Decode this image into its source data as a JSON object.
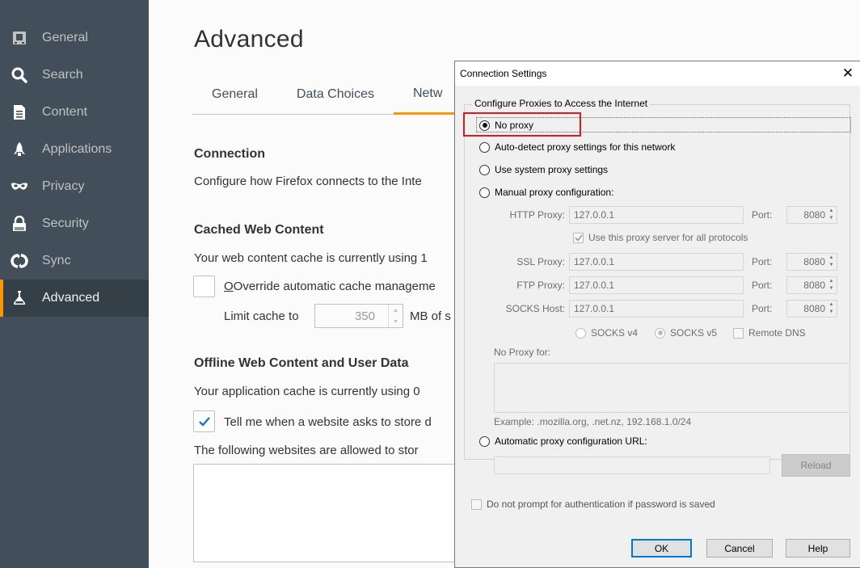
{
  "sidebar": {
    "items": [
      {
        "label": "General",
        "icon": "general-icon"
      },
      {
        "label": "Search",
        "icon": "search-icon"
      },
      {
        "label": "Content",
        "icon": "content-icon"
      },
      {
        "label": "Applications",
        "icon": "applications-icon"
      },
      {
        "label": "Privacy",
        "icon": "privacy-mask-icon"
      },
      {
        "label": "Security",
        "icon": "security-lock-icon"
      },
      {
        "label": "Sync",
        "icon": "sync-icon"
      },
      {
        "label": "Advanced",
        "icon": "advanced-icon"
      }
    ],
    "active": "Advanced"
  },
  "main": {
    "title": "Advanced",
    "tabs": [
      {
        "label": "General"
      },
      {
        "label": "Data Choices"
      },
      {
        "label": "Netw"
      }
    ],
    "connection": {
      "title": "Connection",
      "text": "Configure how Firefox connects to the Inte"
    },
    "cache": {
      "title": "Cached Web Content",
      "text": "Your web content cache is currently using 1",
      "override_label": "Override automatic cache manageme",
      "limit_label": "Limit cache to",
      "limit_value": "350",
      "unit_label": "MB of s"
    },
    "offline": {
      "title": "Offline Web Content and User Data",
      "text": "Your application cache is currently using 0",
      "tell_me_label": "Tell me when a website asks to store d",
      "allowed_text": "The following websites are allowed to stor"
    }
  },
  "dialog": {
    "title": "Connection Settings",
    "close_glyph": "✕",
    "group_label": "Configure Proxies to Access the Internet",
    "options": {
      "no_proxy": "No proxy",
      "auto_detect": "Auto-detect proxy settings for this network",
      "system": "Use system proxy settings",
      "manual": "Manual proxy configuration:",
      "auto_url": "Automatic proxy configuration URL:"
    },
    "http_label": "HTTP Proxy:",
    "http_value": "127.0.0.1",
    "http_port": "8080",
    "same_proxy_label": "Use this proxy server for all protocols",
    "ssl_label": "SSL Proxy:",
    "ssl_value": "127.0.0.1",
    "ssl_port": "8080",
    "ftp_label": "FTP Proxy:",
    "ftp_value": "127.0.0.1",
    "ftp_port": "8080",
    "socks_label": "SOCKS Host:",
    "socks_value": "127.0.0.1",
    "socks_port": "8080",
    "port_label": "Port:",
    "socks_v4": "SOCKS v4",
    "socks_v5": "SOCKS v5",
    "remote_dns": "Remote DNS",
    "no_proxy_for_label": "No Proxy for:",
    "example_text": "Example: .mozilla.org, .net.nz, 192.168.1.0/24",
    "reload_label": "Reload",
    "no_prompt_label": "Do not prompt for authentication if password is saved",
    "ok_label": "OK",
    "cancel_label": "Cancel",
    "help_label": "Help"
  },
  "colors": {
    "sidebar_bg": "#424f5a",
    "accent": "#ff9500",
    "highlight": "#e0191f",
    "default_button": "#0078d7"
  }
}
